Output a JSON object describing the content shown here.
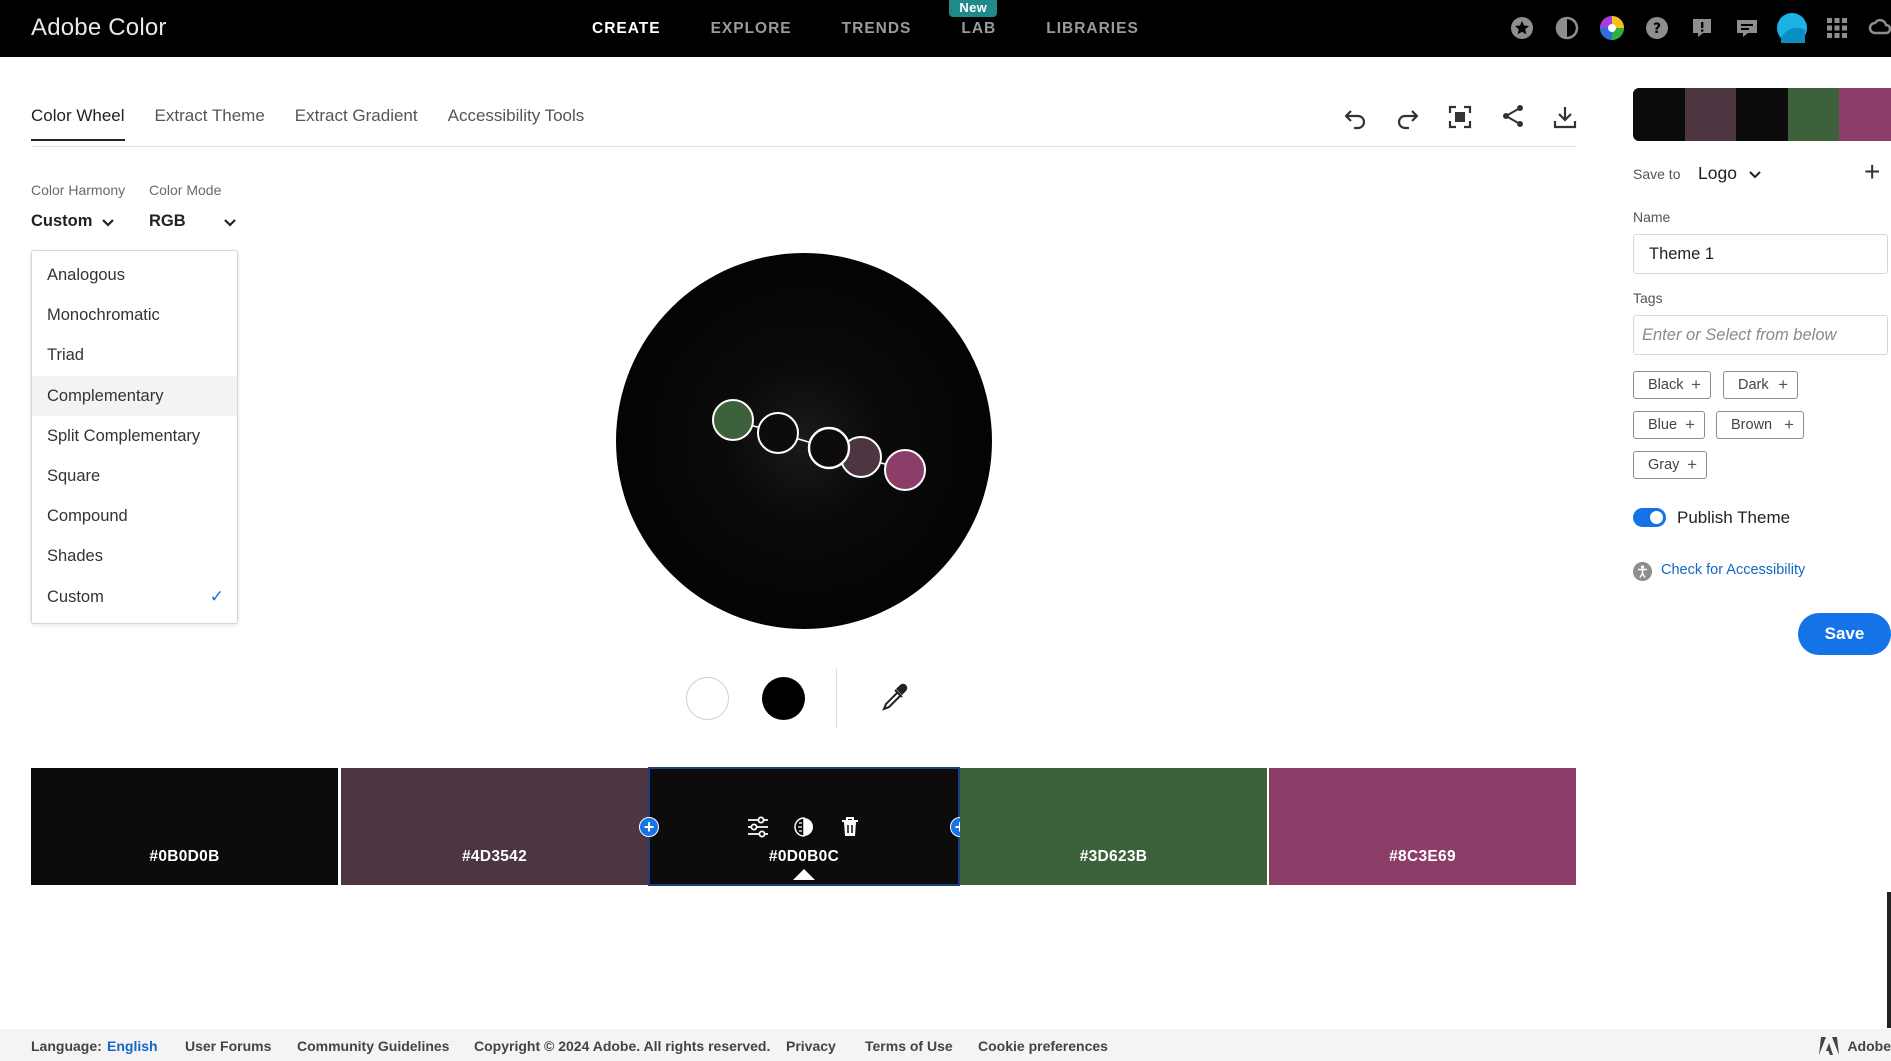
{
  "app": {
    "title": "Adobe Color"
  },
  "topnav": {
    "items": [
      "CREATE",
      "EXPLORE",
      "TRENDS",
      "LAB",
      "LIBRARIES"
    ],
    "active": "CREATE",
    "badge": "New",
    "icons": [
      "star-icon",
      "contrast-icon",
      "color-wheel-icon",
      "help-icon",
      "feedback-icon",
      "chat-icon",
      "avatar",
      "apps-grid-icon",
      "creative-cloud-icon"
    ]
  },
  "subtabs": {
    "items": [
      "Color Wheel",
      "Extract Theme",
      "Extract Gradient",
      "Accessibility Tools"
    ],
    "active": "Color Wheel"
  },
  "toolbar": {
    "icons": [
      "undo-icon",
      "redo-icon",
      "fullscreen-icon",
      "share-icon",
      "download-icon"
    ]
  },
  "harmony": {
    "label": "Color Harmony",
    "value": "Custom",
    "options": [
      "Analogous",
      "Monochromatic",
      "Triad",
      "Complementary",
      "Split Complementary",
      "Square",
      "Compound",
      "Shades",
      "Custom"
    ],
    "selected": "Custom",
    "hovered": "Complementary"
  },
  "mode": {
    "label": "Color Mode",
    "value": "RGB"
  },
  "theme": {
    "colors": [
      "#0B0D0B",
      "#4D3542",
      "#0D0B0C",
      "#3D623B",
      "#8C3E69"
    ],
    "selected_index": 2
  },
  "right_panel": {
    "save_to_label": "Save to",
    "save_to_value": "Logo",
    "name_label": "Name",
    "name_value": "Theme 1",
    "tags_label": "Tags",
    "tags_placeholder": "Enter or Select from below",
    "tags": [
      "Black",
      "Dark",
      "Blue",
      "Brown",
      "Gray"
    ],
    "publish_label": "Publish Theme",
    "publish_on": true,
    "a11y_link": "Check for Accessibility",
    "save_label": "Save"
  },
  "footer": {
    "language_label": "Language:",
    "language_value": "English",
    "links": [
      "User Forums",
      "Community Guidelines",
      "Copyright © 2024 Adobe. All rights reserved.",
      "Privacy",
      "Terms of Use",
      "Cookie preferences"
    ],
    "brand": "Adobe"
  }
}
